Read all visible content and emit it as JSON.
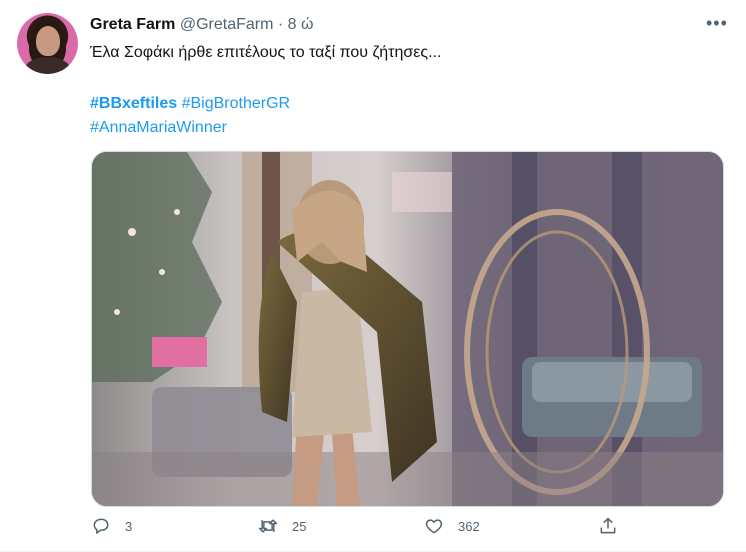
{
  "tweet": {
    "author_name": "Greta Farm",
    "handle": "@GretaFarm",
    "separator": "·",
    "time": "8 ώ",
    "more_icon": "more-icon",
    "text": "Έλα Σοφάκι ήρθε επιτέλους το ταξί που ζήτησες...",
    "hashtags": [
      "#BBxeftiles",
      "#BigBrotherGR",
      "#AnnaMariaWinner"
    ],
    "actions": {
      "reply_count": "3",
      "retweet_count": "25",
      "like_count": "362"
    }
  },
  "colors": {
    "accent": "#1d9bf0",
    "secondary_text": "#536471",
    "primary_text": "#0f1419"
  }
}
